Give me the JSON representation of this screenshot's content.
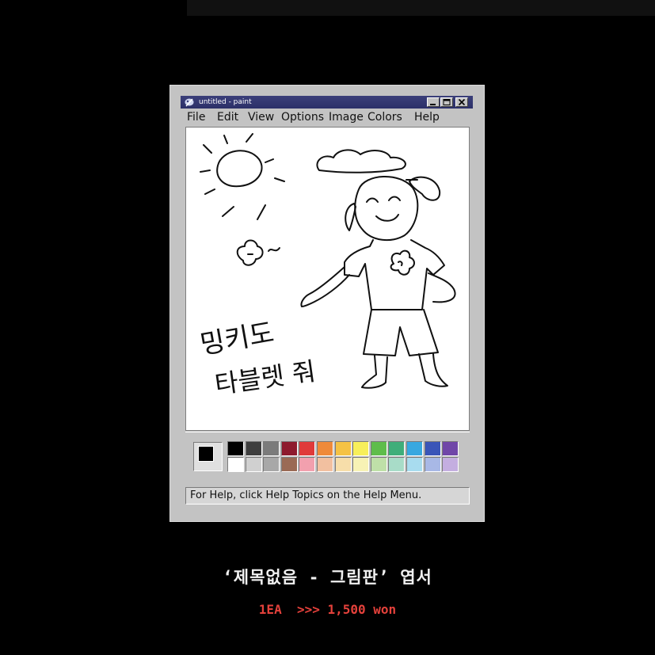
{
  "window": {
    "title": "untitled - paint",
    "menus": [
      "File",
      "Edit",
      "View",
      "Options",
      "Image",
      "Colors",
      "Help"
    ],
    "status_text": "For Help, click Help Topics on the Help Menu."
  },
  "drawing": {
    "handwritten_text_line1": "밍키도",
    "handwritten_text_line2": "타블렛 줘"
  },
  "palette": {
    "foreground_color": "#000000",
    "background_color": "#ffffff",
    "top_row": [
      "#000000",
      "#3e3e3e",
      "#7b7b7b",
      "#8e1b2e",
      "#e03a3a",
      "#ef8a3a",
      "#f5c244",
      "#f7ef5a",
      "#5fbd4b",
      "#3fae7a",
      "#38a8e0",
      "#3a55b8",
      "#7046a8"
    ],
    "bottom_row": [
      "#ffffff",
      "#d0d0d0",
      "#a8a8a8",
      "#9a6a55",
      "#f2a0ae",
      "#f2c0a0",
      "#f7deaa",
      "#f7f2b5",
      "#bfe0a8",
      "#a8dcc8",
      "#a8dcef",
      "#a8b8e6",
      "#c4aee0"
    ]
  },
  "caption": {
    "product": "‘제목없음 - 그림판’ 엽서",
    "price": "1EA  >>> 1,500 won"
  }
}
